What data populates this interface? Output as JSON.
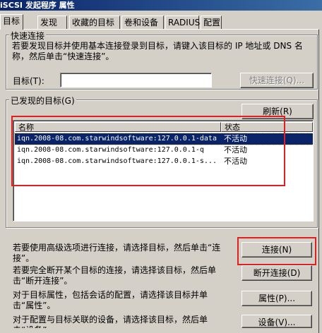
{
  "window": {
    "title": "iSCSI 发起程序 属性"
  },
  "tabs": [
    "目标",
    "发现",
    "收藏的目标",
    "卷和设备",
    "RADIUS",
    "配置"
  ],
  "quick_connect": {
    "legend": "快速连接",
    "description": "若要发现目标并使用基本连接登录到目标，请键入该目标的 IP 地址或 DNS 名称，然后单击“快速连接”。",
    "target_label": "目标(T):",
    "target_value": "",
    "button": "快速连接(Q)..."
  },
  "discovered": {
    "legend": "已发现的目标(G)",
    "refresh_button": "刷新(R)",
    "columns": [
      "名称",
      "状态"
    ],
    "rows": [
      {
        "name": "iqn.2008-08.com.starwindsoftware:127.0.0.1-data",
        "status": "不活动",
        "selected": true
      },
      {
        "name": "iqn.2008-08.com.starwindsoftware:127.0.0.1-q",
        "status": "不活动",
        "selected": false
      },
      {
        "name": "iqn.2008-08.com.starwindsoftware:127.0.0.1-s...",
        "status": "不活动",
        "selected": false
      }
    ]
  },
  "actions": {
    "connect_desc": "若要使用高级选项进行连接，请选择目标，然后单击“连接”。",
    "connect_button": "连接(N)",
    "disconnect_desc": "若要完全断开某个目标的连接，请选择该目标，然后单击“断开连接”。",
    "disconnect_button": "断开连接(D)",
    "properties_desc": "对于目标属性，包括会话的配置，请选择该目标并单击“属性”。",
    "properties_button": "属性(P)...",
    "devices_desc": "对于配置与目标关联的设备，请选择该目标，然后单击“设备”。",
    "devices_button": "设备(V)..."
  }
}
